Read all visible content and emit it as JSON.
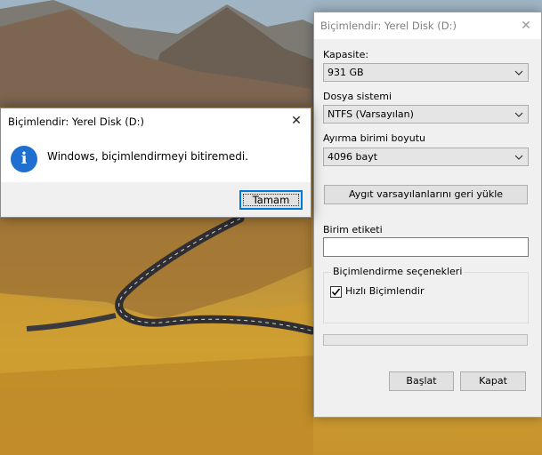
{
  "format_dialog": {
    "title": "Biçimlendir: Yerel Disk (D:)",
    "capacity_label": "Kapasite:",
    "capacity_value": "931 GB",
    "filesystem_label": "Dosya sistemi",
    "filesystem_value": "NTFS (Varsayılan)",
    "alloc_label": "Ayırma birimi boyutu",
    "alloc_value": "4096 bayt",
    "restore_defaults_label": "Aygıt varsayılanlarını geri yükle",
    "volume_label_label": "Birim etiketi",
    "volume_label_value": "",
    "options_group_label": "Biçimlendirme seçenekleri",
    "quick_format_label": "Hızlı Biçimlendir",
    "quick_format_checked": true,
    "progress": 0,
    "start_label": "Başlat",
    "close_label": "Kapat"
  },
  "message_box": {
    "title": "Biçimlendir: Yerel Disk (D:)",
    "message": "Windows, biçimlendirmeyi bitiremedi.",
    "ok_label": "Tamam",
    "icon": "info-icon"
  },
  "colors": {
    "accent": "#0078d7",
    "info_icon": "#1e6fd0",
    "dialog_bg": "#f0f0f0"
  }
}
